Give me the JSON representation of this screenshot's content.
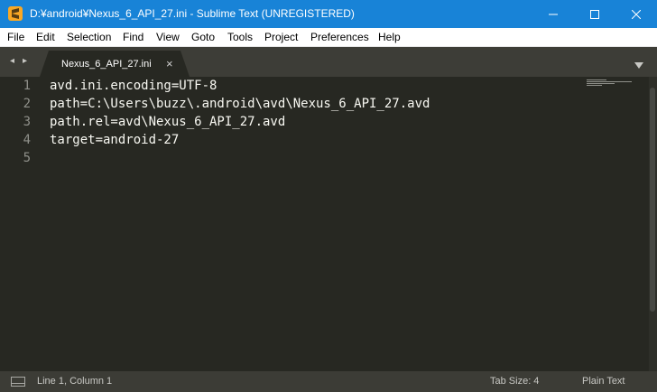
{
  "window": {
    "title": "D:¥android¥Nexus_6_API_27.ini - Sublime Text (UNREGISTERED)",
    "icon": "sublime-text-icon",
    "accent_color": "#1883d7"
  },
  "menu": [
    "File",
    "Edit",
    "Selection",
    "Find",
    "View",
    "Goto",
    "Tools",
    "Project",
    "Preferences",
    "Help"
  ],
  "tabs": {
    "nav_left": "◂",
    "nav_right": "▸",
    "active": {
      "label": "Nexus_6_API_27.ini",
      "close": "×"
    },
    "dropdown_icon": "chevron-down-icon"
  },
  "editor": {
    "lines": [
      {
        "num": "1",
        "text": "avd.ini.encoding=UTF-8"
      },
      {
        "num": "2",
        "text": "path=C:\\Users\\buzz\\.android\\avd\\Nexus_6_API_27.avd"
      },
      {
        "num": "3",
        "text": "path.rel=avd\\Nexus_6_API_27.avd"
      },
      {
        "num": "4",
        "text": "target=android-27"
      },
      {
        "num": "5",
        "text": ""
      }
    ],
    "background": "#272822",
    "text_color": "#f8f8f2"
  },
  "status": {
    "position": "Line 1, Column 1",
    "tab_size": "Tab Size: 4",
    "syntax": "Plain Text"
  }
}
